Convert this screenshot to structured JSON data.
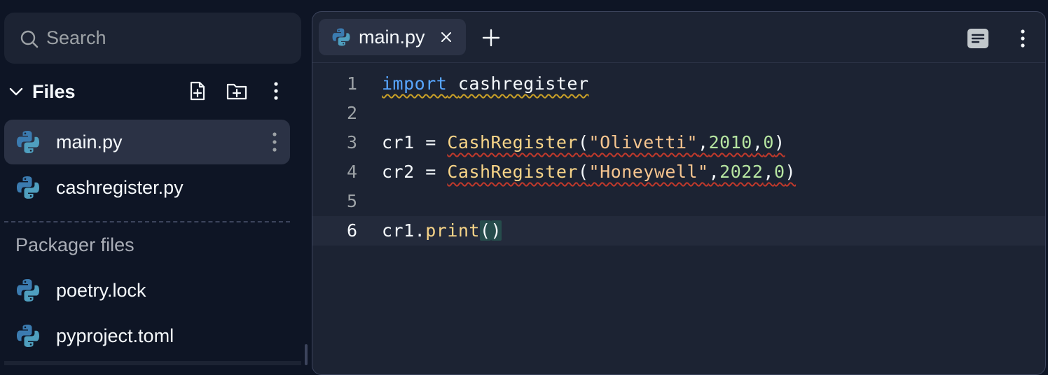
{
  "search": {
    "placeholder": "Search",
    "icon": "search-icon"
  },
  "files": {
    "title": "Files",
    "actions": [
      "new-file-icon",
      "new-folder-icon",
      "more-vertical-icon"
    ],
    "items": [
      {
        "name": "main.py",
        "active": true,
        "icon": "python-icon"
      },
      {
        "name": "cashregister.py",
        "active": false,
        "icon": "python-icon"
      }
    ]
  },
  "packager": {
    "title": "Packager files",
    "items": [
      {
        "name": "poetry.lock",
        "icon": "python-icon"
      },
      {
        "name": "pyproject.toml",
        "icon": "python-icon"
      }
    ]
  },
  "editor": {
    "tab": {
      "label": "main.py",
      "icon": "python-icon"
    },
    "toolbar": [
      "add-tab-icon",
      "layout-icon",
      "more-vertical-icon"
    ],
    "current_line": 6,
    "lines": [
      {
        "n": "1",
        "code": "import cashregister"
      },
      {
        "n": "2",
        "code": ""
      },
      {
        "n": "3",
        "code": "cr1 = CashRegister(\"Olivetti\",2010,0)"
      },
      {
        "n": "4",
        "code": "cr2 = CashRegister(\"Honeywell\",2022,0)"
      },
      {
        "n": "5",
        "code": ""
      },
      {
        "n": "6",
        "code": "cr1.print()"
      }
    ],
    "tokens": {
      "import": "import",
      "module": "cashregister",
      "cr1": "cr1",
      "cr2": "cr2",
      "eq": "=",
      "cls": "CashRegister",
      "s1": "\"Olivetti\"",
      "s2": "\"Honeywell\"",
      "y1": "2010",
      "y2": "2022",
      "zero": "0",
      "print": "print",
      "dot": ".",
      "comma": ",",
      "lp": "(",
      "rp": ")"
    }
  },
  "colors": {
    "background": "#0e1525",
    "panel": "#1c2333",
    "active": "#2b3245",
    "keyword": "#58a6ff",
    "function": "#f7d488",
    "string": "#f6c58f",
    "number": "#b6e5a1",
    "python_blue": "#3b7bb0",
    "python_teal": "#4f9fbf"
  }
}
